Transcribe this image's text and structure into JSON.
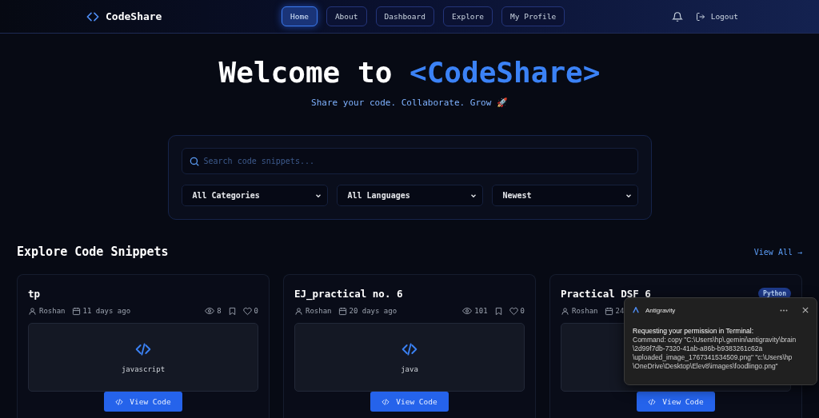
{
  "navbar": {
    "brand": "CodeShare",
    "links": [
      {
        "label": "Home",
        "selected": true
      },
      {
        "label": "About",
        "selected": false
      },
      {
        "label": "Dashboard",
        "selected": false
      },
      {
        "label": "Explore",
        "selected": false
      },
      {
        "label": "My Profile",
        "selected": false
      }
    ],
    "logout": "Logout"
  },
  "hero": {
    "title": "Welcome to",
    "title_highlight": "<CodeShare>",
    "subtitle": "Share your code. Collaborate. Grow 🚀"
  },
  "filters": {
    "search": {
      "placeholder": "Search code snippets..."
    },
    "selects": [
      "All Categories",
      "All Languages",
      "Newest"
    ]
  },
  "section": {
    "title": "Explore Code Snippets",
    "link": "View All →"
  },
  "snippets": [
    {
      "title": "tp",
      "author": "Roshan",
      "date": "11 days ago",
      "views": "8",
      "likes": "0",
      "language": "javascript",
      "button": "View Code"
    },
    {
      "title": "EJ_practical no. 6",
      "author": "Roshan",
      "date": "20 days ago",
      "views": "101",
      "likes": "0",
      "language": "java",
      "button": "View Code"
    },
    {
      "title": "Practical DSF 6",
      "badge": "Python",
      "author": "Roshan",
      "date": "24",
      "button": "View Code"
    }
  ],
  "notification": {
    "app": "Antigravity",
    "heading": "Requesting your permission in Terminal:",
    "body": "Command: copy \"C:\\Users\\hp\\.gemini\\antigravity\\brain\\2d99f7db-7320-41ab-a86b-b9383261c62a\\uploaded_image_1767341534509.png\" \"c:\\Users\\hp\\OneDrive\\Desktop\\Elev8\\images\\foodlingo.png\""
  }
}
